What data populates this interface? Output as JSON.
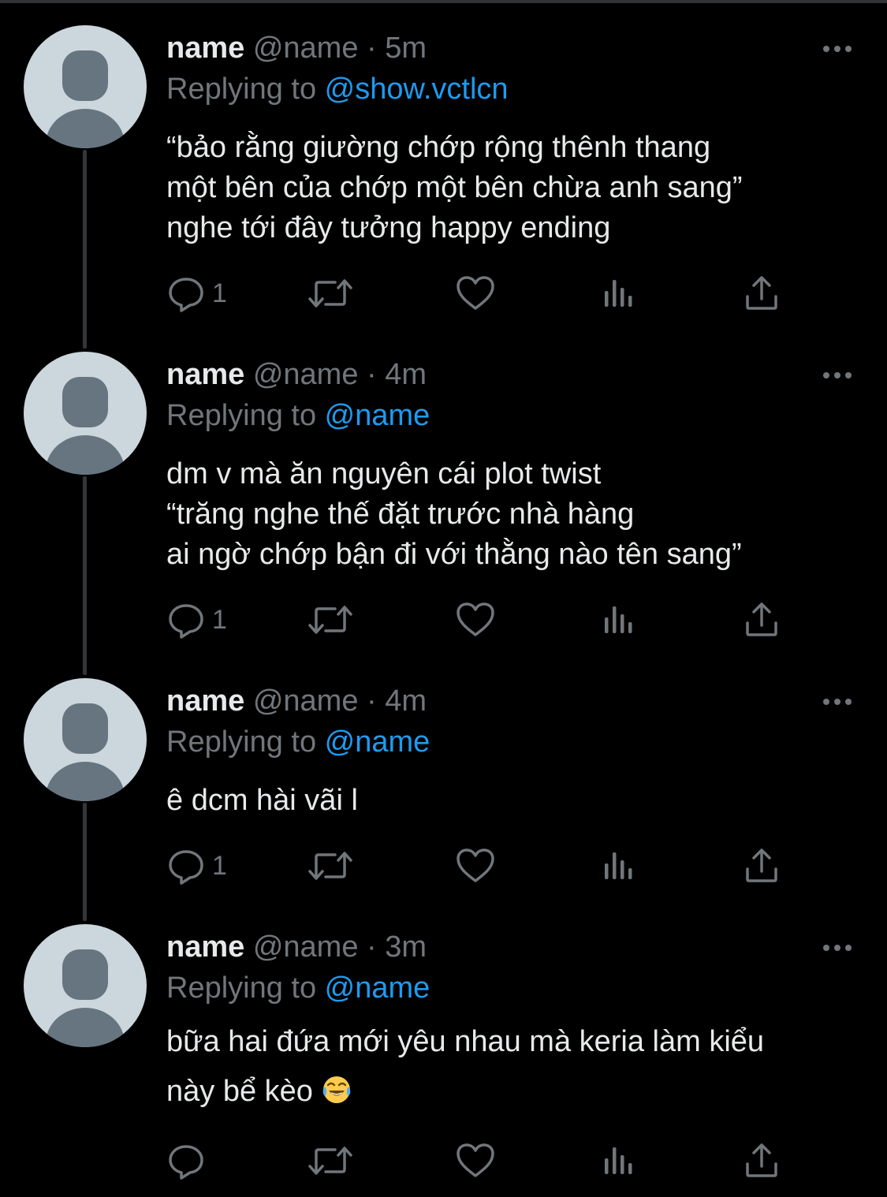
{
  "thread": [
    {
      "display_name": "name",
      "handle": "@name",
      "dot": "·",
      "time": "5m",
      "replying_prefix": "Replying to ",
      "replying_to": "@show.vctlcn",
      "lines": [
        "“bảo rằng giường chớp rộng thênh thang",
        "một bên của chớp một bên chừa anh sang”",
        "nghe tới đây tưởng happy ending"
      ],
      "reply_count": "1",
      "emoji": ""
    },
    {
      "display_name": "name",
      "handle": "@name",
      "dot": "·",
      "time": "4m",
      "replying_prefix": "Replying to ",
      "replying_to": "@name",
      "lines": [
        "dm v mà ăn nguyên cái plot twist",
        "“trăng nghe thế đặt trước nhà hàng",
        "ai ngờ chớp bận đi với thằng nào tên sang”"
      ],
      "reply_count": "1",
      "emoji": ""
    },
    {
      "display_name": "name",
      "handle": "@name",
      "dot": "·",
      "time": "4m",
      "replying_prefix": "Replying to ",
      "replying_to": "@name",
      "lines": [
        "ê dcm hài vãi l"
      ],
      "reply_count": "1",
      "emoji": ""
    },
    {
      "display_name": "name",
      "handle": "@name",
      "dot": "·",
      "time": "3m",
      "replying_prefix": "Replying to ",
      "replying_to": "@name",
      "lines": [
        "bữa hai đứa mới yêu nhau mà keria làm kiểu",
        "này bể kèo"
      ],
      "reply_count": "",
      "emoji": "face-with-tears-of-joy-emoji"
    }
  ],
  "icons": {
    "more": "more-horizontal-icon",
    "reply": "reply-icon",
    "retweet": "retweet-icon",
    "like": "like-icon",
    "views": "views-icon",
    "share": "share-icon"
  },
  "colors": {
    "background": "#000000",
    "text_primary": "#e7e9ea",
    "text_secondary": "#71767b",
    "accent": "#1d9bf0",
    "avatar_bg": "#ccd6dd",
    "avatar_fg": "#66757f",
    "thread_line": "#333639"
  }
}
